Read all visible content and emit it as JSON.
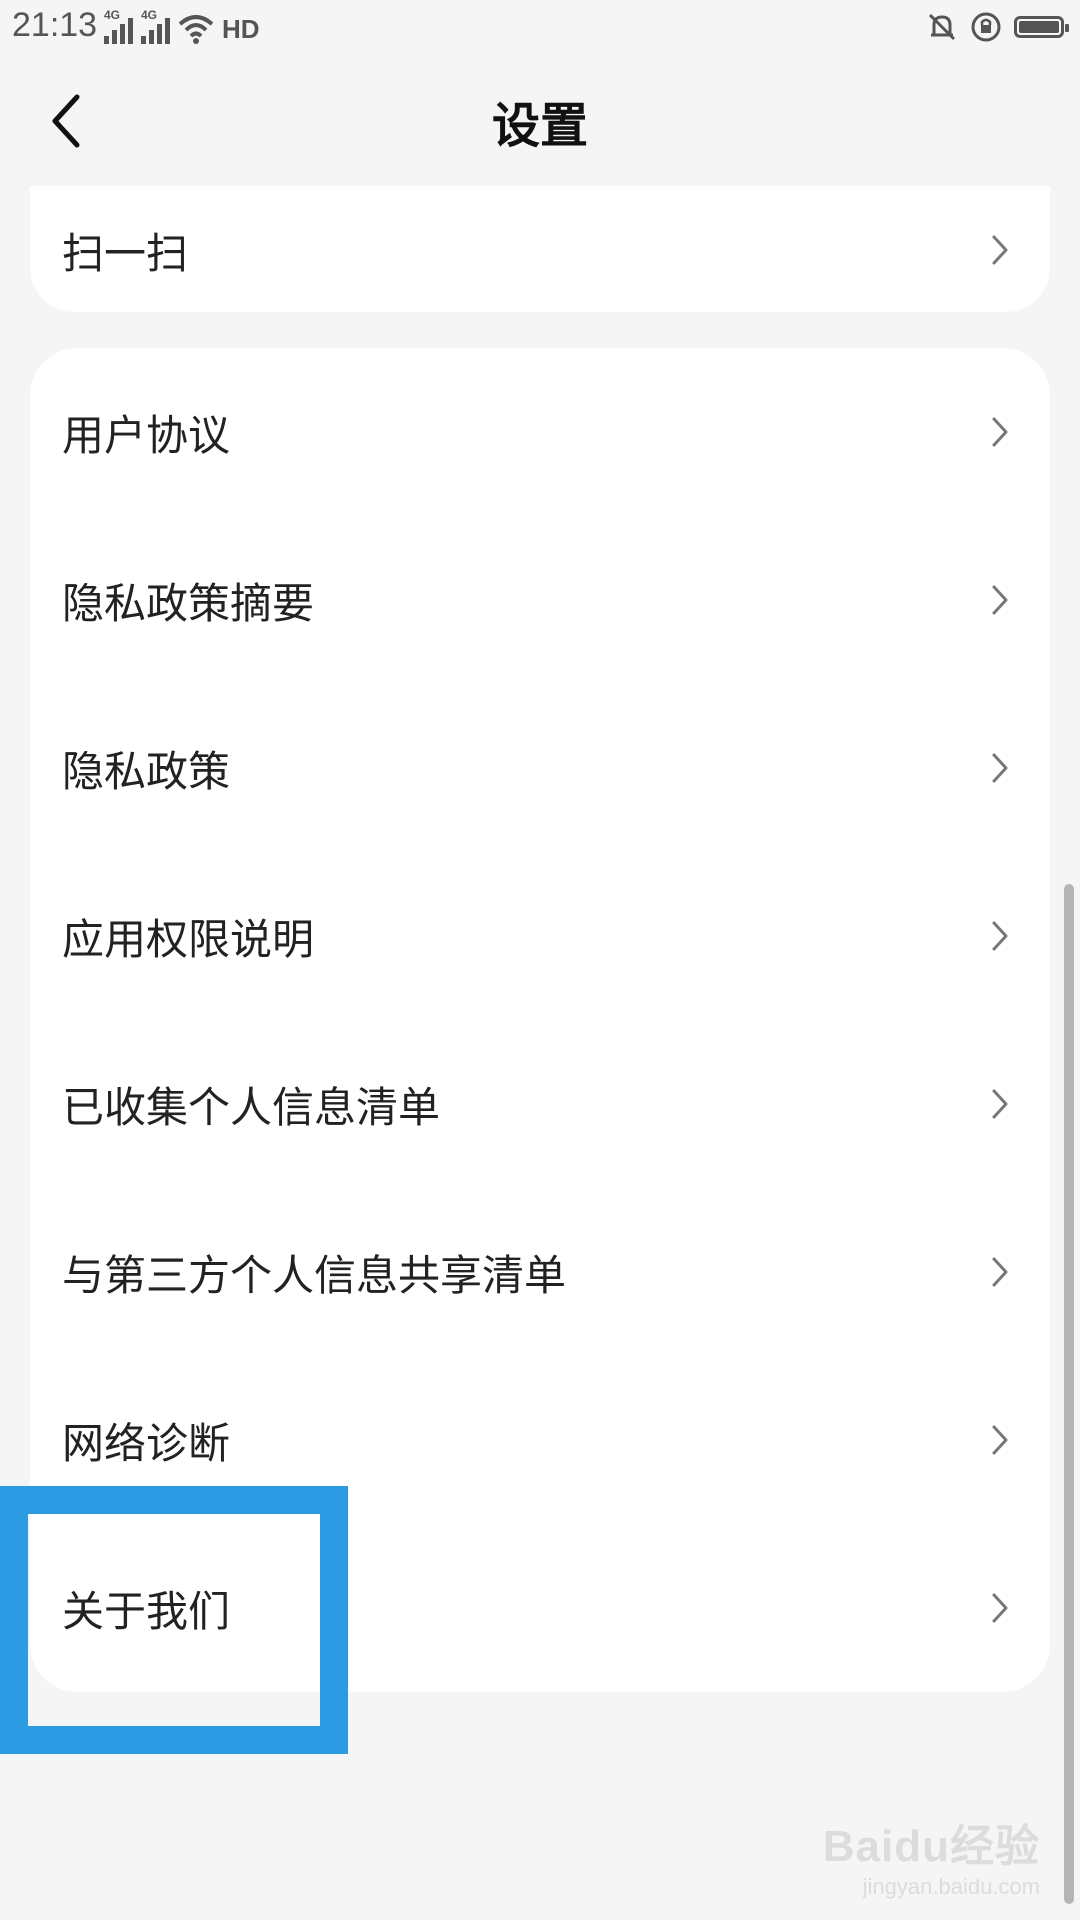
{
  "status_bar": {
    "time": "21:13",
    "network_tags": [
      "4G",
      "4G"
    ],
    "hd_label": "HD",
    "icons": [
      "signal-icon",
      "signal-icon",
      "wifi-icon",
      "hd-icon",
      "mute-icon",
      "rotation-lock-icon",
      "battery-icon"
    ]
  },
  "header": {
    "title": "设置",
    "back_icon": "chevron-left-icon"
  },
  "settings": {
    "top_item": {
      "label": "扫一扫"
    },
    "items": [
      {
        "label": "用户协议"
      },
      {
        "label": "隐私政策摘要"
      },
      {
        "label": "隐私政策"
      },
      {
        "label": "应用权限说明"
      },
      {
        "label": "已收集个人信息清单"
      },
      {
        "label": "与第三方个人信息共享清单"
      },
      {
        "label": "网络诊断"
      },
      {
        "label": "关于我们"
      }
    ]
  },
  "highlight": {
    "color": "#2b9be4"
  },
  "watermark": {
    "main": "Baidu经验",
    "sub": "jingyan.baidu.com"
  }
}
